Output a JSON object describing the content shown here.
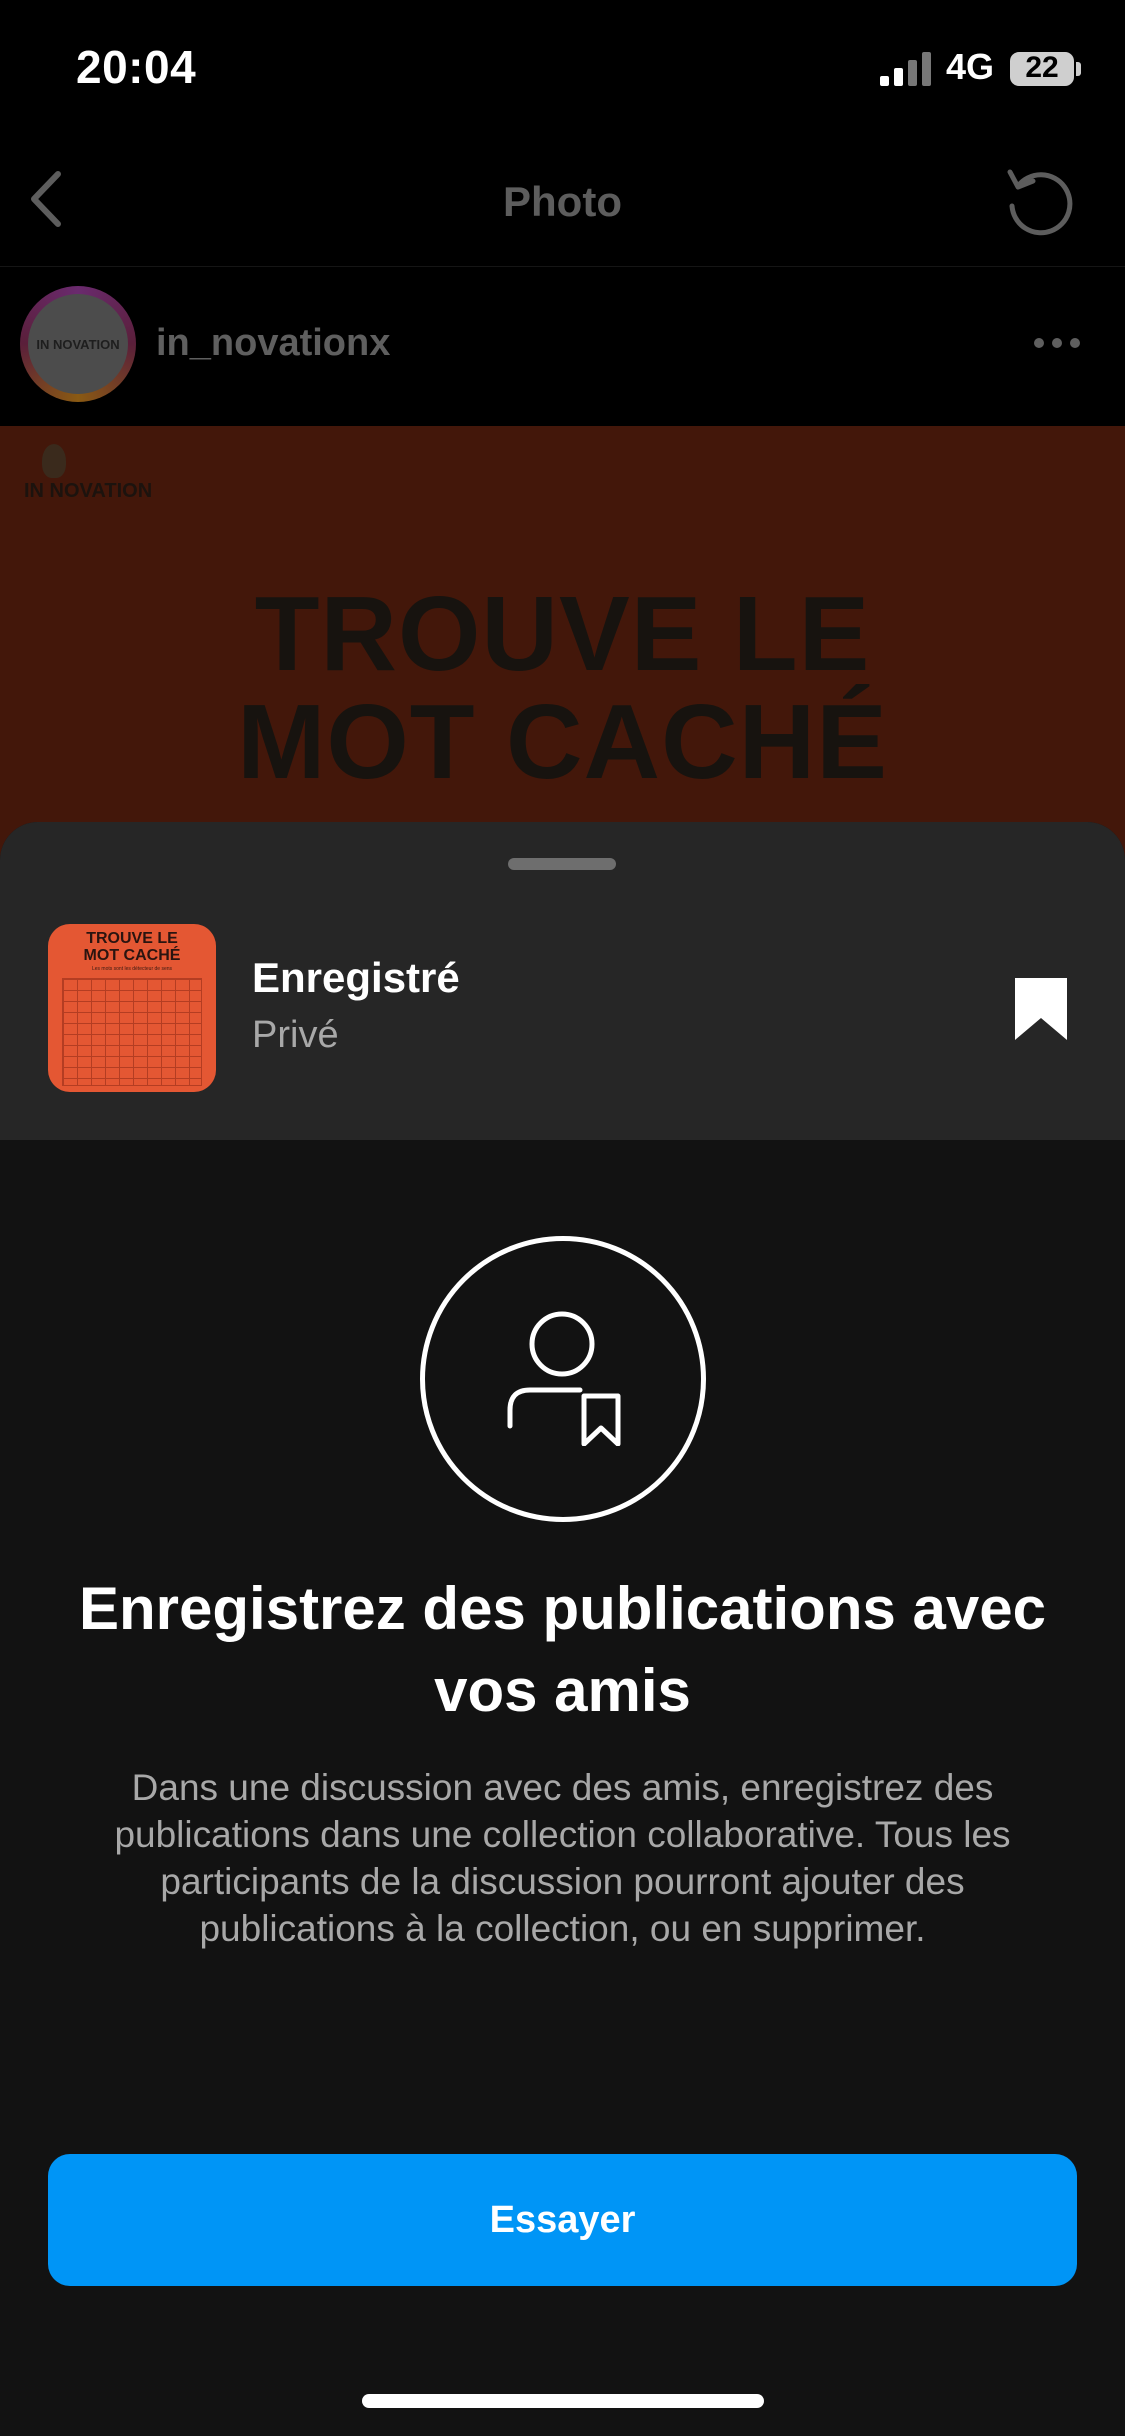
{
  "status_bar": {
    "time": "20:04",
    "network": "4G",
    "battery": "22"
  },
  "nav": {
    "title": "Photo",
    "back_icon": "chevron-left-icon",
    "refresh_icon": "refresh-icon"
  },
  "post": {
    "username": "in_novationx",
    "avatar_text": "IN NOVATION",
    "logo_text": "IN NOVATION",
    "headline_line1": "TROUVE LE",
    "headline_line2": "MOT CACHÉ"
  },
  "sheet": {
    "saved_title": "Enregistré",
    "saved_subtitle": "Privé",
    "thumbnail": {
      "title_line1": "TROUVE LE",
      "title_line2": "MOT CACHÉ",
      "subtitle": "Les mots sont les détecteur de sens"
    },
    "headline": "Enregistrez des publications avec vos amis",
    "body": "Dans une discussion avec des amis, enregistrez des publications dans une collection collaborative. Tous les participants de la discussion pourront ajouter des publications à la collection, ou en supprimer.",
    "cta_label": "Essayer"
  },
  "colors": {
    "accent": "#0095f6",
    "sheet_background": "#121212",
    "sheet_header_background": "#262626",
    "post_background": "#43170a"
  }
}
